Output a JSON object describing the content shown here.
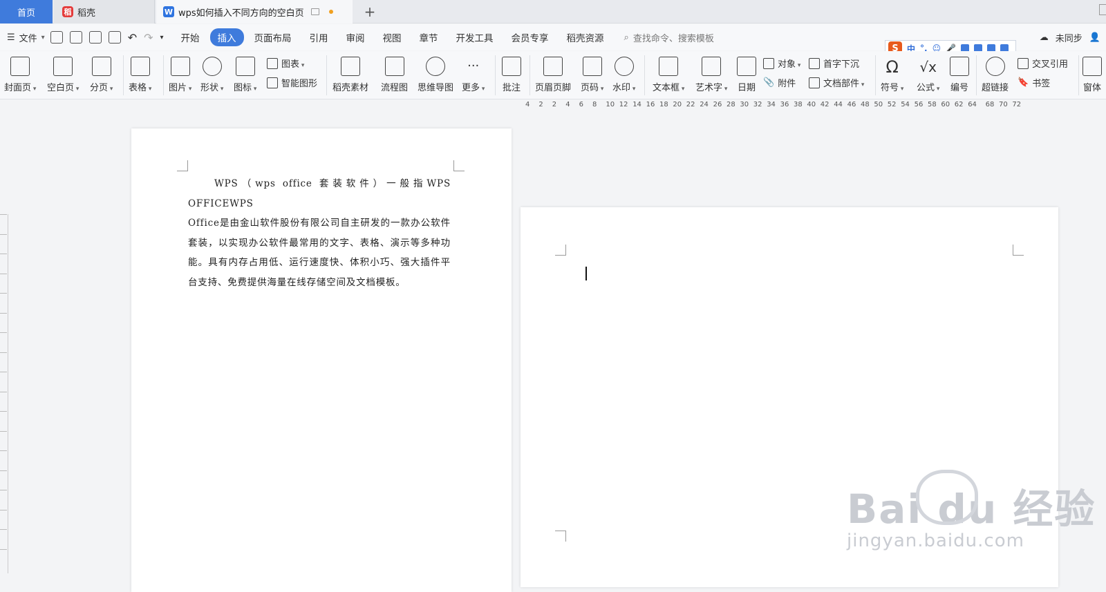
{
  "tabs": {
    "home": "首页",
    "daoke": "稻壳",
    "doc_title": "wps如何插入不同方向的空白页",
    "add": "+"
  },
  "menubar": {
    "file": "文件",
    "tabs": [
      "开始",
      "插入",
      "页面布局",
      "引用",
      "审阅",
      "视图",
      "章节",
      "开发工具",
      "会员专享",
      "稻壳资源"
    ],
    "active_tab": "插入",
    "search_placeholder": "查找命令、搜索模板",
    "sync_status": "未同步"
  },
  "ime": {
    "mode": "中"
  },
  "ribbon": {
    "cover": "封面页",
    "blank": "空白页",
    "pagebreak": "分页",
    "table": "表格",
    "picture": "图片",
    "shape": "形状",
    "icon": "图标",
    "chart": "图表",
    "smartart": "智能图形",
    "daoke_material": "稻壳素材",
    "flowchart": "流程图",
    "mindmap": "思维导图",
    "more": "更多",
    "comment": "批注",
    "header_footer": "页眉页脚",
    "page_number": "页码",
    "watermark": "水印",
    "textbox": "文本框",
    "wordart": "艺术字",
    "date": "日期",
    "object": "对象",
    "attachment": "附件",
    "dropcap": "首字下沉",
    "doc_parts": "文档部件",
    "symbol": "符号",
    "formula": "公式",
    "numbering": "编号",
    "hyperlink": "超链接",
    "crossref": "交叉引用",
    "bookmark": "书签",
    "window": "窗体"
  },
  "ruler": {
    "ticks": [
      "4",
      "2",
      "2",
      "4",
      "6",
      "8",
      "10",
      "12",
      "14",
      "16",
      "18",
      "20",
      "22",
      "24",
      "26",
      "28",
      "30",
      "32",
      "34",
      "36",
      "38",
      "40",
      "42",
      "44",
      "46",
      "48",
      "50",
      "52",
      "54",
      "56",
      "58",
      "60",
      "62",
      "64",
      "68",
      "70",
      "72"
    ]
  },
  "document": {
    "line1": "WPS（wps office 套装软件）一般指WPS OFFICEWPS",
    "line2": "Office是由金山软件股份有限公司自主研发的一款办公软件套装，以实现办公软件最常用的文字、表格、演示等多种功能。具有内存占用低、运行速度快、体积小巧、强大插件平台支持、免费提供海量在线存储空间及文档模板。"
  },
  "watermark": {
    "brand": "Bai du 经验",
    "url": "jingyan.baidu.com"
  }
}
